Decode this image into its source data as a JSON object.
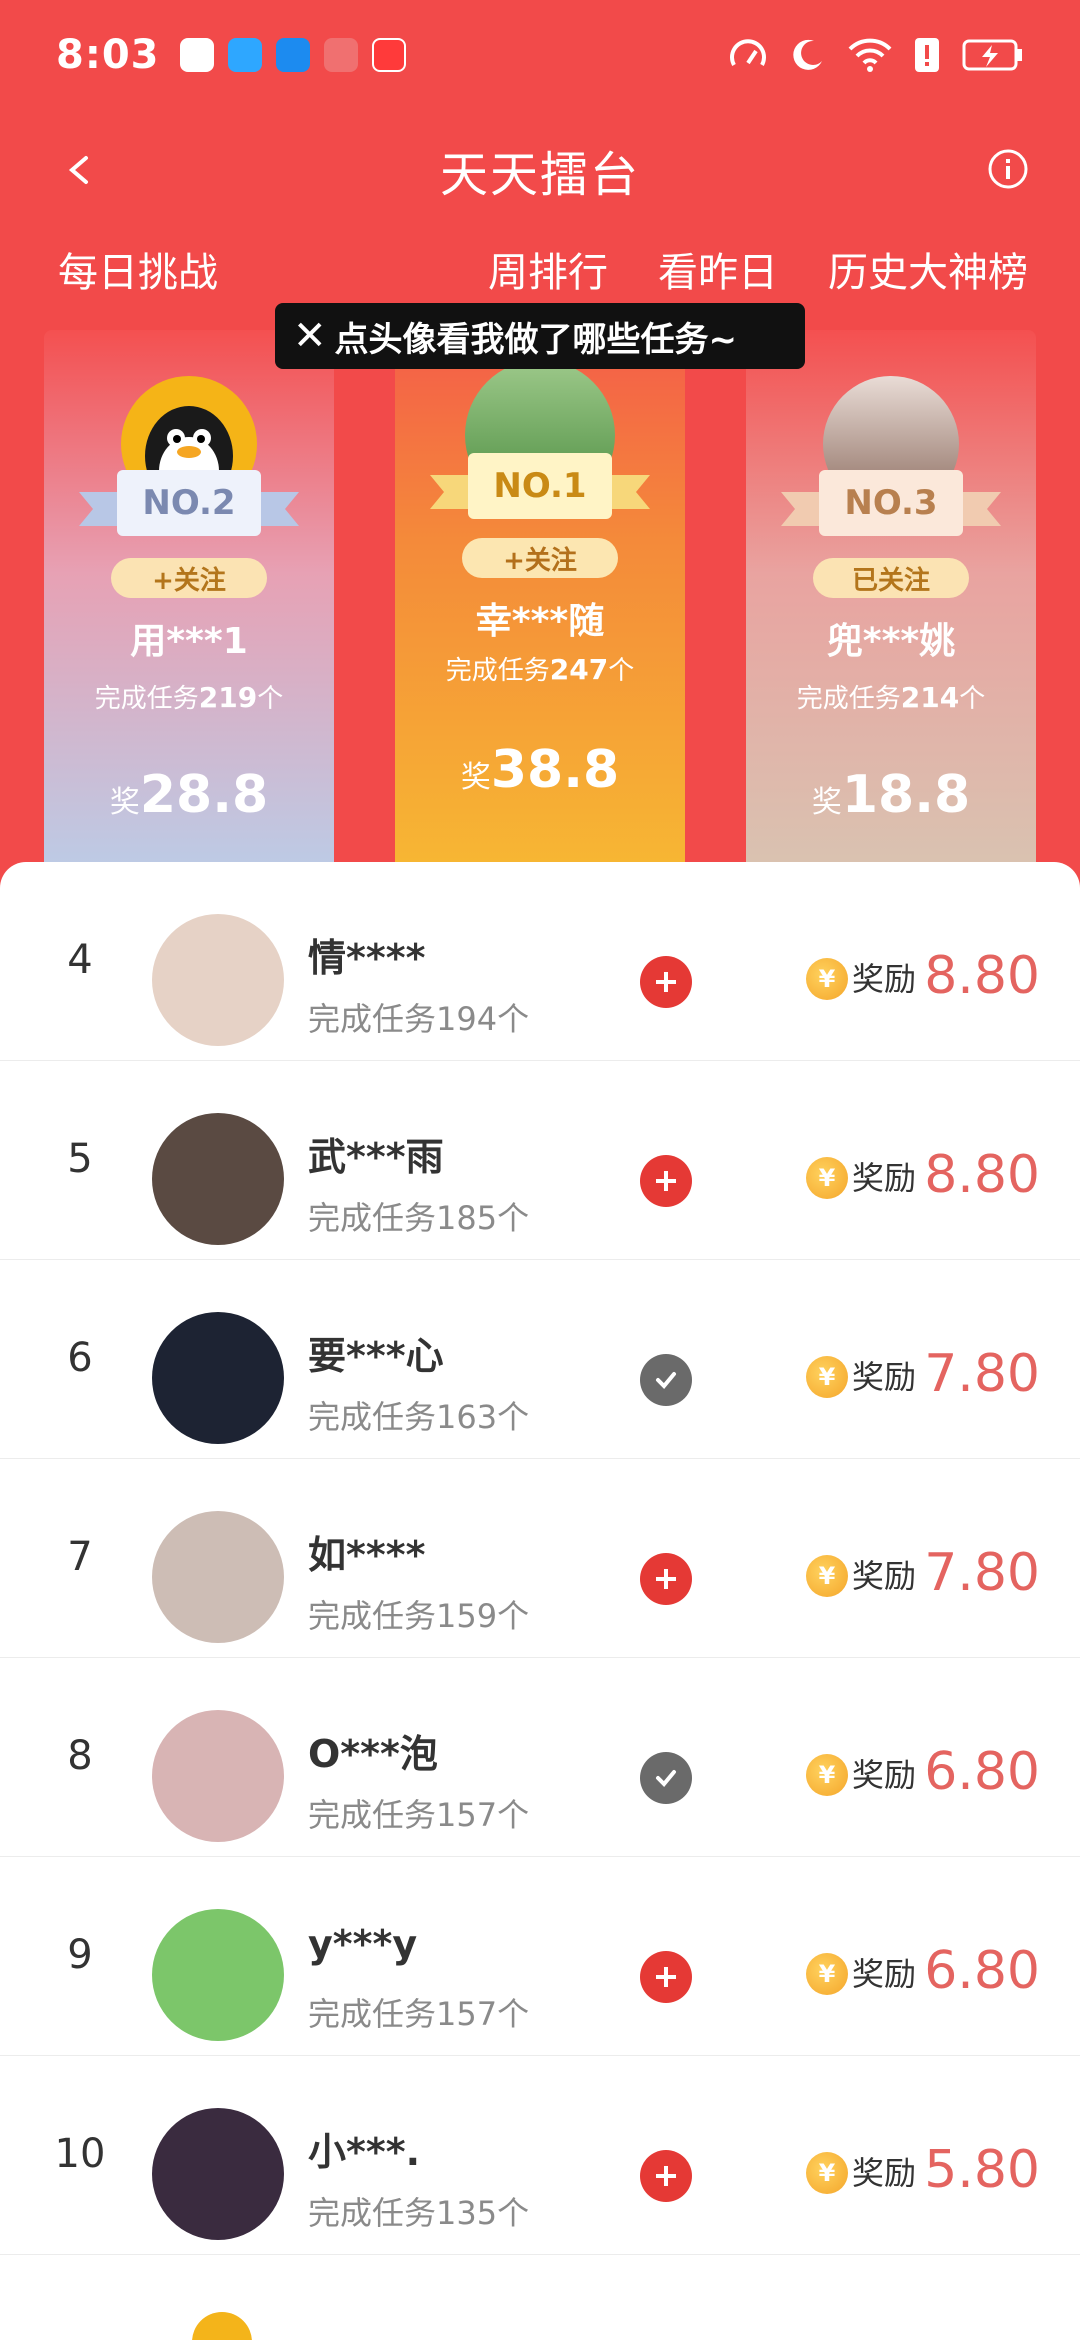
{
  "status": {
    "time": "8:03",
    "icons": [
      "qq-icon",
      "message-icon",
      "nav-icon",
      "book-icon",
      "app-icon",
      "speed-icon",
      "moon-icon",
      "wifi-icon",
      "alert-icon",
      "battery-icon"
    ]
  },
  "header": {
    "title": "天天擂台",
    "back_icon": "back-arrow-icon",
    "info_icon": "info-icon"
  },
  "tabs": {
    "daily": "每日挑战",
    "weekly": "周排行",
    "yesterday": "看昨日",
    "history": "历史大神榜"
  },
  "tooltip": {
    "close": "✕",
    "text": "点头像看我做了哪些任务~"
  },
  "podium": [
    {
      "rank_label": "NO.2",
      "follow": "+关注",
      "name": "用***1",
      "task_prefix": "完成任务",
      "task_count": "219",
      "task_suffix": "个",
      "reward_prefix": "奖",
      "reward": "28.8"
    },
    {
      "rank_label": "NO.1",
      "follow": "+关注",
      "name": "幸***随",
      "task_prefix": "完成任务",
      "task_count": "247",
      "task_suffix": "个",
      "reward_prefix": "奖",
      "reward": "38.8"
    },
    {
      "rank_label": "NO.3",
      "follow": "已关注",
      "name": "兜***姚",
      "task_prefix": "完成任务",
      "task_count": "214",
      "task_suffix": "个",
      "reward_prefix": "奖",
      "reward": "18.8"
    }
  ],
  "list": [
    {
      "rank": "4",
      "name": "情****",
      "task": "完成任务194个",
      "followed": false,
      "reward_label": "奖励",
      "reward": "8.80",
      "avatar_color": "#e6d2c6"
    },
    {
      "rank": "5",
      "name": "武***雨",
      "task": "完成任务185个",
      "followed": false,
      "reward_label": "奖励",
      "reward": "8.80",
      "avatar_color": "#5a4a42"
    },
    {
      "rank": "6",
      "name": "要***心",
      "task": "完成任务163个",
      "followed": true,
      "reward_label": "奖励",
      "reward": "7.80",
      "avatar_color": "#1d2333"
    },
    {
      "rank": "7",
      "name": "如****",
      "task": "完成任务159个",
      "followed": false,
      "reward_label": "奖励",
      "reward": "7.80",
      "avatar_color": "#cdbdb5"
    },
    {
      "rank": "8",
      "name": "O***泡",
      "task": "完成任务157个",
      "followed": true,
      "reward_label": "奖励",
      "reward": "6.80",
      "avatar_color": "#d8b4b4"
    },
    {
      "rank": "9",
      "name": "y***y",
      "task": "完成任务157个",
      "followed": false,
      "reward_label": "奖励",
      "reward": "6.80",
      "avatar_color": "#7cc66a"
    },
    {
      "rank": "10",
      "name": "小***.",
      "task": "完成任务135个",
      "followed": false,
      "reward_label": "奖励",
      "reward": "5.80",
      "avatar_color": "#3a2b3f"
    }
  ],
  "coin_symbol": "¥",
  "colors": {
    "brand_red": "#f24a4a",
    "reward_red": "#e46460",
    "add_red": "#e53935",
    "followed_gray": "#6a6a6a"
  }
}
